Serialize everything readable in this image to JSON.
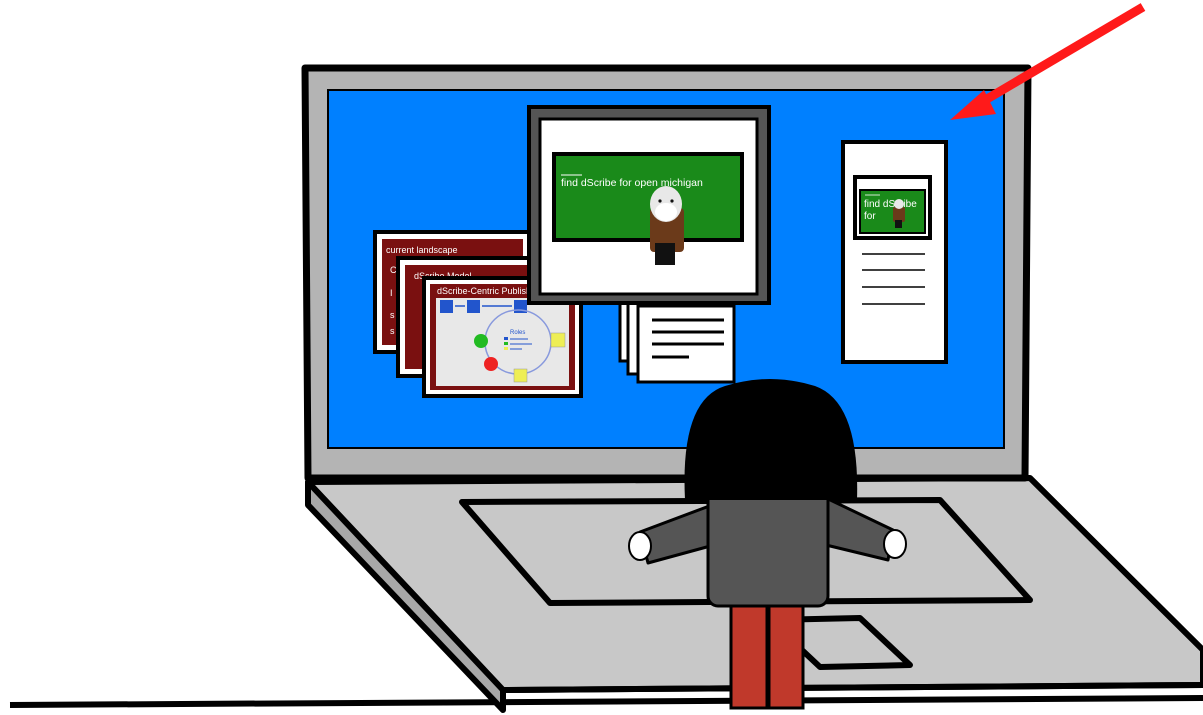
{
  "slides": {
    "back": {
      "title": "current landscape"
    },
    "middle": {
      "title": "dScribe Model"
    },
    "front": {
      "title": "dScribe-Centric Publishing",
      "roles_label": "Roles"
    }
  },
  "video_window": {
    "caption": "find dScribe for open michigan"
  },
  "document_window": {
    "caption_line1": "find dScribe",
    "caption_line2": "for"
  },
  "colors": {
    "desktop": "#0080ff",
    "laptop_body": "#c8c8c8",
    "chalkboard": "#1a8a1a",
    "slide_maroon": "#7a1010",
    "arrow": "#ff1a1a",
    "person_pants": "#c0392b"
  }
}
